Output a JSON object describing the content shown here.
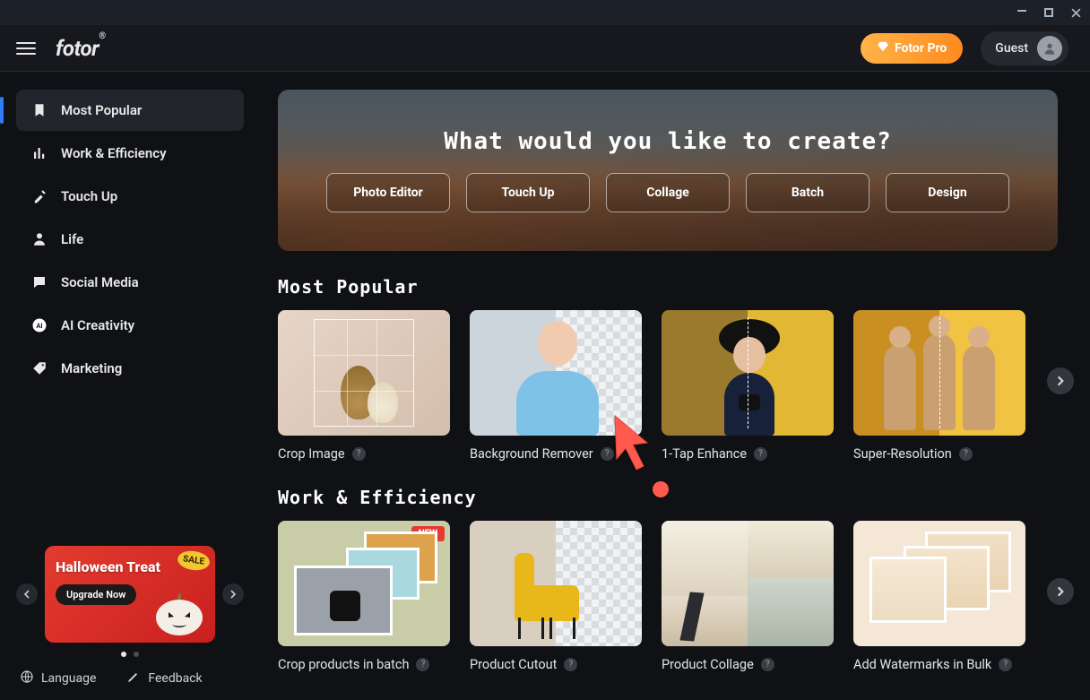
{
  "window": {
    "minimize": "–",
    "maximize": "□",
    "close": "✕"
  },
  "brand": {
    "name": "fotor",
    "reg": "®"
  },
  "topbar": {
    "pro_label": "Fotor Pro",
    "guest_label": "Guest"
  },
  "sidebar": {
    "items": [
      {
        "label": "Most Popular",
        "icon": "bookmark-icon"
      },
      {
        "label": "Work & Efficiency",
        "icon": "bars-icon"
      },
      {
        "label": "Touch Up",
        "icon": "wand-icon"
      },
      {
        "label": "Life",
        "icon": "person-icon"
      },
      {
        "label": "Social Media",
        "icon": "chat-icon"
      },
      {
        "label": "AI Creativity",
        "icon": "ai-icon"
      },
      {
        "label": "Marketing",
        "icon": "tag-icon"
      }
    ],
    "promo": {
      "badge": "SALE",
      "title": "Halloween Treat",
      "cta": "Upgrade Now"
    },
    "bottom": {
      "language": "Language",
      "feedback": "Feedback"
    }
  },
  "hero": {
    "title": "What would you like to create?",
    "buttons": [
      "Photo Editor",
      "Touch Up",
      "Collage",
      "Batch",
      "Design"
    ]
  },
  "sections": {
    "popular": {
      "title": "Most Popular",
      "cards": [
        {
          "label": "Crop Image"
        },
        {
          "label": "Background Remover"
        },
        {
          "label": "1-Tap Enhance"
        },
        {
          "label": "Super-Resolution"
        }
      ]
    },
    "work": {
      "title": "Work & Efficiency",
      "cards": [
        {
          "label": "Crop products in batch",
          "badge": "NEW"
        },
        {
          "label": "Product Cutout"
        },
        {
          "label": "Product Collage"
        },
        {
          "label": "Add Watermarks in Bulk"
        }
      ]
    }
  }
}
